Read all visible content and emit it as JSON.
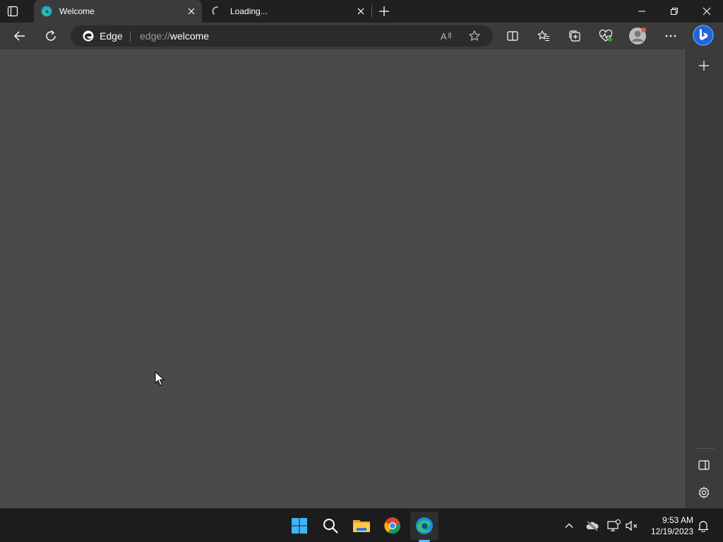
{
  "browser": {
    "tabs": [
      {
        "title": "Welcome",
        "favicon": "edge-logo-icon",
        "active": true
      },
      {
        "title": "Loading...",
        "favicon": "loading-spinner-icon",
        "active": false
      }
    ],
    "address_bar": {
      "site_chip_label": "Edge",
      "url_scheme": "edge://",
      "url_host": "welcome"
    }
  },
  "taskbar": {
    "apps": [
      "windows-start-icon",
      "search-icon",
      "file-explorer-icon",
      "chrome-icon",
      "edge-icon"
    ],
    "clock": {
      "time": "9:53 AM",
      "date": "12/19/2023"
    }
  },
  "colors": {
    "titlebar": "#202020",
    "toolbar": "#3b3b3b",
    "content": "#4a4a4a",
    "taskbar": "#1c1c1c",
    "accent": "#4cc2ff"
  }
}
